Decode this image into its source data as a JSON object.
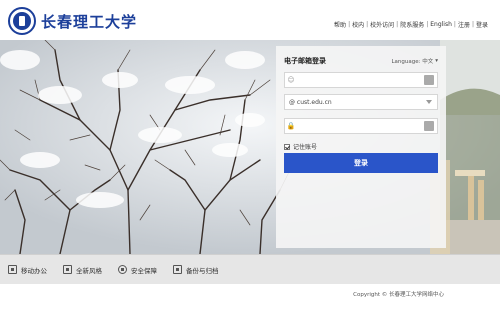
{
  "header": {
    "university_name": "长春理工大学",
    "nav": [
      "帮助",
      "校内",
      "校外访问",
      "院系服务",
      "English",
      "注册",
      "登录"
    ]
  },
  "login": {
    "title": "电子邮箱登录",
    "language_label": "Language: 中文",
    "username_placeholder": "",
    "domain_value": "@ cust.edu.cn",
    "password_placeholder": "",
    "remember_label": "记住账号",
    "submit_label": "登录"
  },
  "bottombar": {
    "items": [
      "移动办公",
      "全新风格",
      "安全保障",
      "备份与归档"
    ]
  },
  "footer": {
    "copyright": "Copyright © 长春理工大学网络中心"
  },
  "colors": {
    "brand": "#1c3f9a",
    "button": "#2a55c9"
  }
}
